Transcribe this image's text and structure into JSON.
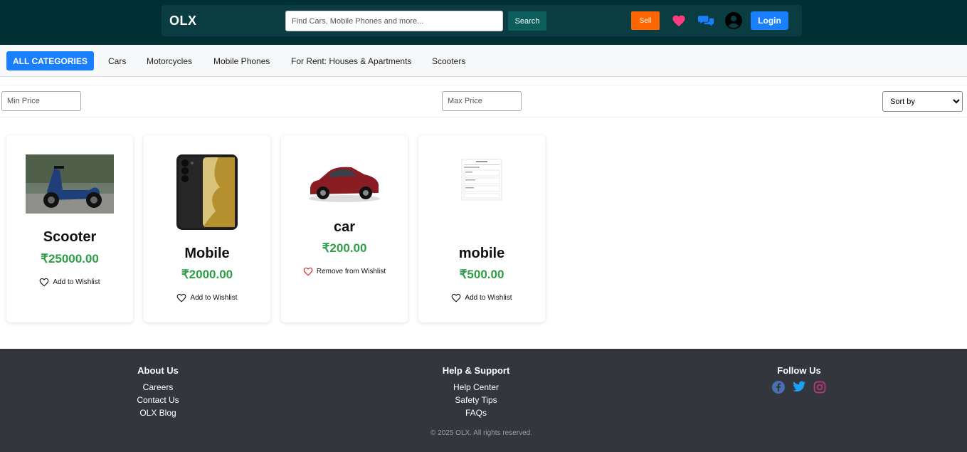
{
  "header": {
    "logo": "OLX",
    "search_placeholder": "Find Cars, Mobile Phones and more...",
    "search_button": "Search",
    "sell_button": "Sell",
    "login_button": "Login",
    "icons": [
      "heart-icon",
      "chat-icon",
      "user-icon"
    ],
    "colors": {
      "bg": "#002f34",
      "sell": "#ff6600",
      "login": "#1a7fff",
      "heart": "#ff3d7f"
    }
  },
  "categories": {
    "all_label": "ALL CATEGORIES",
    "items": [
      "Cars",
      "Motorcycles",
      "Mobile Phones",
      "For Rent: Houses & Apartments",
      "Scooters"
    ]
  },
  "filters": {
    "min_placeholder": "Min Price",
    "max_placeholder": "Max Price",
    "sort_label": "Sort by"
  },
  "products": [
    {
      "title": "Scooter",
      "price": "₹25000.00",
      "wishlist": "Add to Wishlist",
      "image": "scooter-image"
    },
    {
      "title": "Mobile",
      "price": "₹2000.00",
      "wishlist": "Add to Wishlist",
      "image": "phone-image"
    },
    {
      "title": "car",
      "price": "₹200.00",
      "wishlist": "Remove from Wishlist",
      "image": "car-image"
    },
    {
      "title": "mobile",
      "price": "₹500.00",
      "wishlist": "Add to Wishlist",
      "image": "document-image"
    }
  ],
  "footer": {
    "about": {
      "title": "About Us",
      "links": [
        "Careers",
        "Contact Us",
        "OLX Blog"
      ]
    },
    "help": {
      "title": "Help & Support",
      "links": [
        "Help Center",
        "Safety Tips",
        "FAQs"
      ]
    },
    "follow": {
      "title": "Follow Us",
      "icons": [
        "facebook-icon",
        "twitter-icon",
        "instagram-icon"
      ]
    },
    "copyright": "© 2025 OLX. All rights reserved."
  }
}
